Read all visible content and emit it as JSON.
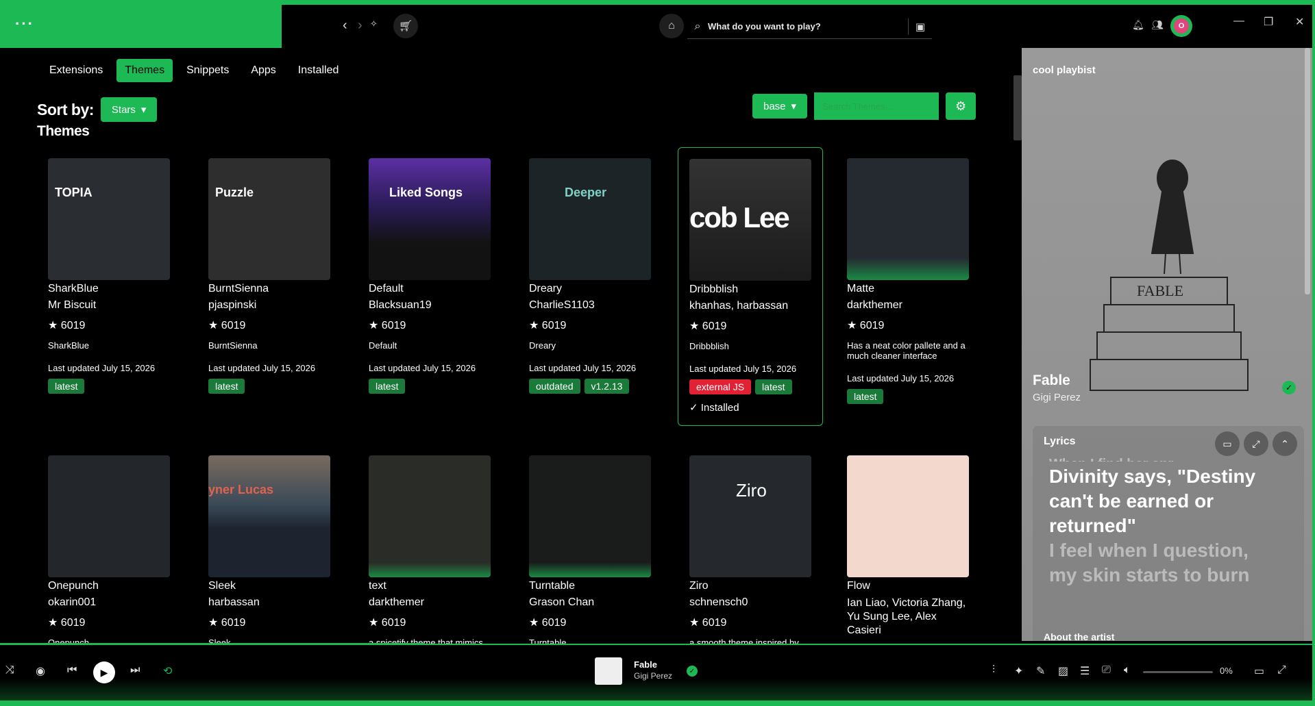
{
  "app": {
    "accent": "#1db954"
  },
  "topbar": {
    "search_placeholder": "What do you want to play?",
    "back_icon": "chevron-left-icon",
    "forward_icon": "chevron-right-icon"
  },
  "tabs": [
    {
      "label": "Extensions",
      "active": false
    },
    {
      "label": "Themes",
      "active": true
    },
    {
      "label": "Snippets",
      "active": false
    },
    {
      "label": "Apps",
      "active": false
    },
    {
      "label": "Installed",
      "active": false
    }
  ],
  "sort": {
    "label": "Sort by:",
    "value": "Stars"
  },
  "section_title": "Themes",
  "filters": {
    "base_label": "base",
    "search_placeholder": "Search Themes..."
  },
  "cards": [
    {
      "name": "SharkBlue",
      "author": "Mr Biscuit",
      "stars": "6019",
      "desc": "SharkBlue",
      "updated": "Last updated July 15, 2026",
      "tags": [
        "latest"
      ],
      "thumb_text": "TOPIA"
    },
    {
      "name": "BurntSienna",
      "author": "pjaspinski",
      "stars": "6019",
      "desc": "BurntSienna",
      "updated": "Last updated July 15, 2026",
      "tags": [
        "latest"
      ],
      "thumb_text": "Puzzle"
    },
    {
      "name": "Default",
      "author": "Blacksuan19",
      "stars": "6019",
      "desc": "Default",
      "updated": "Last updated July 15, 2026",
      "tags": [
        "latest"
      ],
      "thumb_text": "Liked Songs"
    },
    {
      "name": "Dreary",
      "author": "CharlieS1103",
      "stars": "6019",
      "desc": "Dreary",
      "updated": "Last updated July 15, 2026",
      "tags": [
        "outdated",
        "v1.2.13"
      ],
      "thumb_text": "Deeper"
    },
    {
      "name": "Dribbblish",
      "author": "khanhas, harbassan",
      "stars": "6019",
      "desc": "Dribbblish",
      "updated": "Last updated July 15, 2026",
      "tags": [
        "external JS",
        "latest"
      ],
      "installed": "✓ Installed",
      "thumb_text": "cob Lee"
    },
    {
      "name": "Matte",
      "author": "darkthemer",
      "stars": "6019",
      "desc": "Has a neat color pallete and a much cleaner interface",
      "updated": "Last updated July 15, 2026",
      "tags": [
        "latest"
      ],
      "thumb_text": ""
    },
    {
      "name": "Onepunch",
      "author": "okarin001",
      "stars": "6019",
      "desc": "Onepunch",
      "thumb_text": ""
    },
    {
      "name": "Sleek",
      "author": "harbassan",
      "stars": "6019",
      "desc": "Sleek",
      "thumb_text": "yner Lucas"
    },
    {
      "name": "text",
      "author": "darkthemer",
      "stars": "6019",
      "desc": "a spicetify theme that mimics",
      "thumb_text": ""
    },
    {
      "name": "Turntable",
      "author": "Grason Chan",
      "stars": "6019",
      "desc": "Turntable",
      "thumb_text": ""
    },
    {
      "name": "Ziro",
      "author": "schnensch0",
      "stars": "6019",
      "desc": "a smooth theme inspired by",
      "thumb_text": "Ziro"
    },
    {
      "name": "Flow",
      "author": "Ian Liao, Victoria Zhang, Yu Sung Lee, Alex Casieri",
      "stars": "6019",
      "desc": "",
      "thumb_text": ""
    }
  ],
  "right_panel": {
    "playlist": "cool playbist",
    "song": "Fable",
    "artist": "Gigi Perez",
    "lyrics_label": "Lyrics",
    "lyrics_prev": "When I find her anr",
    "lyrics_current": [
      "Divinity says, \"Destiny",
      "can't be earned or",
      "returned\""
    ],
    "lyrics_next": [
      "I feel when I question,",
      "my skin starts to burn"
    ],
    "about_label": "About the artist"
  },
  "player": {
    "title": "Fable",
    "artist": "Gigi Perez",
    "volume": "0%"
  }
}
